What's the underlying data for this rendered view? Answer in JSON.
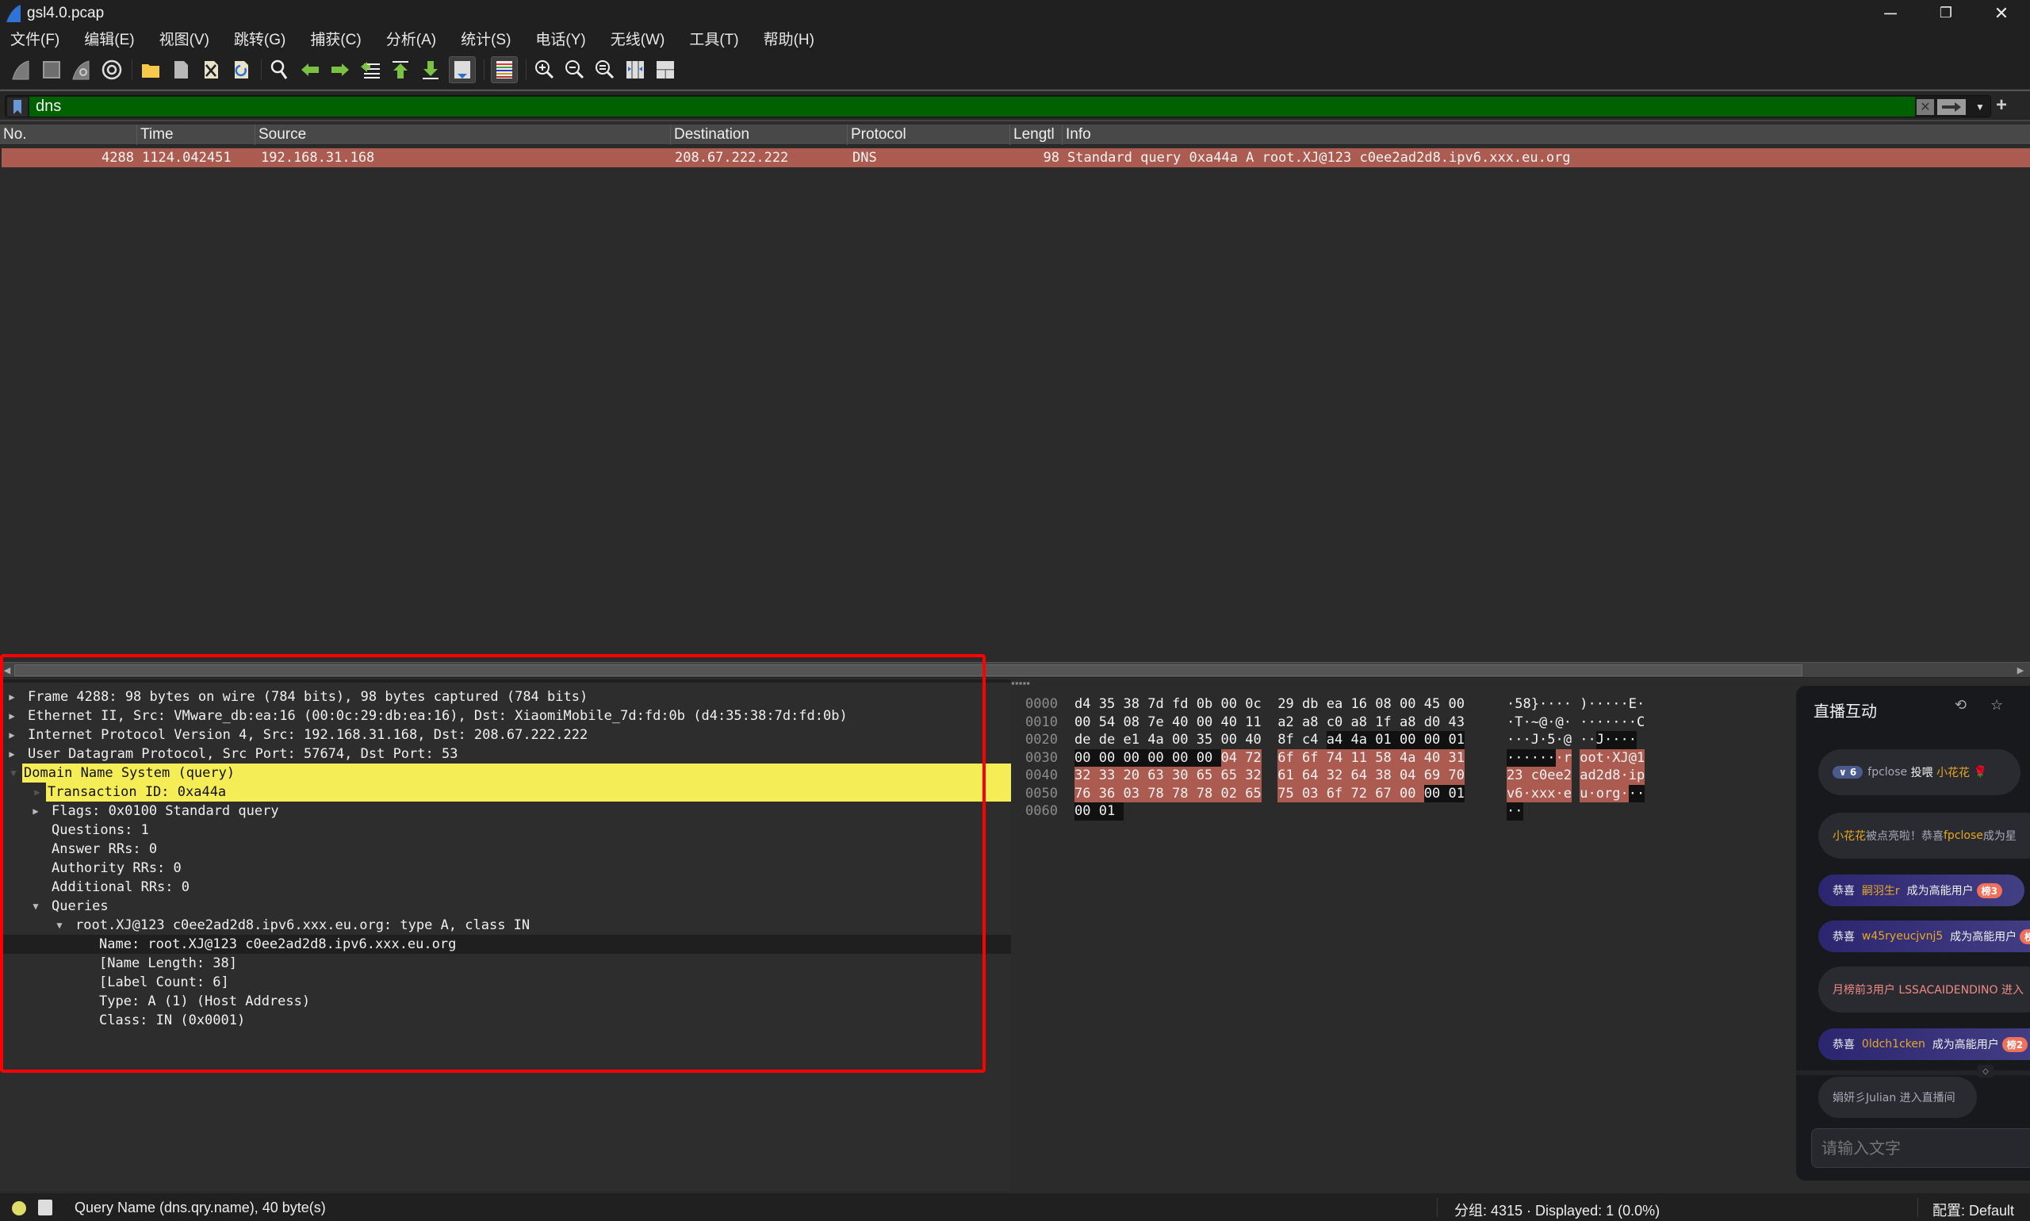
{
  "window": {
    "title": "gsl4.0.pcap",
    "controls": [
      "minimize-icon",
      "restore-icon",
      "close-icon"
    ]
  },
  "menu": [
    "文件(F)",
    "编辑(E)",
    "视图(V)",
    "跳转(G)",
    "捕获(C)",
    "分析(A)",
    "统计(S)",
    "电话(Y)",
    "无线(W)",
    "工具(T)",
    "帮助(H)"
  ],
  "toolbar": [
    "start-capture-icon",
    "stop-capture-icon",
    "restart-capture-icon",
    "capture-options-icon",
    "open-file-icon",
    "save-file-icon",
    "close-file-icon",
    "reload-file-icon",
    "find-packet-icon",
    "go-back-icon",
    "go-forward-icon",
    "go-to-packet-icon",
    "first-packet-icon",
    "last-packet-icon",
    "autoscroll-icon",
    "colorize-icon",
    "zoom-in-icon",
    "zoom-out-icon",
    "zoom-normal-icon",
    "resize-columns-icon",
    "layout-icon"
  ],
  "filter": {
    "value": "dns",
    "color": "#006100"
  },
  "packet_list": {
    "columns": [
      "No.",
      "Time",
      "Source",
      "Destination",
      "Protocol",
      "Length",
      "Info"
    ],
    "column_labels_visible": [
      "No.",
      "Time",
      "Source",
      "Destination",
      "Protocol",
      "Lengtl",
      "Info"
    ],
    "rows": [
      {
        "no": "4288",
        "time": "1124.042451",
        "source": "192.168.31.168",
        "destination": "208.67.222.222",
        "protocol": "DNS",
        "length": "98",
        "info": "Standard query 0xa44a A root.XJ@123 c0ee2ad2d8.ipv6.xxx.eu.org",
        "selected": true,
        "row_color": "#ab5b50"
      }
    ]
  },
  "details": {
    "rows": [
      {
        "level": 0,
        "expander": "collapsed",
        "text": "Frame 4288: 98 bytes on wire (784 bits), 98 bytes captured (784 bits)"
      },
      {
        "level": 0,
        "expander": "collapsed",
        "text": "Ethernet II, Src: VMware_db:ea:16 (00:0c:29:db:ea:16), Dst: XiaomiMobile_7d:fd:0b (d4:35:38:7d:fd:0b)"
      },
      {
        "level": 0,
        "expander": "collapsed",
        "text": "Internet Protocol Version 4, Src: 192.168.31.168, Dst: 208.67.222.222"
      },
      {
        "level": 0,
        "expander": "collapsed",
        "text": "User Datagram Protocol, Src Port: 57674, Dst Port: 53"
      },
      {
        "level": 0,
        "expander": "expanded",
        "text": "Domain Name System (query)",
        "highlight": "yellow"
      },
      {
        "level": 1,
        "expander": "collapsed",
        "text": "Transaction ID: 0xa44a",
        "highlight": "yellow"
      },
      {
        "level": 1,
        "expander": "collapsed",
        "text": "Flags: 0x0100 Standard query"
      },
      {
        "level": 1,
        "expander": "none",
        "text": "Questions: 1"
      },
      {
        "level": 1,
        "expander": "none",
        "text": "Answer RRs: 0"
      },
      {
        "level": 1,
        "expander": "none",
        "text": "Authority RRs: 0"
      },
      {
        "level": 1,
        "expander": "none",
        "text": "Additional RRs: 0"
      },
      {
        "level": 1,
        "expander": "expanded",
        "text": "Queries"
      },
      {
        "level": 2,
        "expander": "expanded",
        "text": "root.XJ@123 c0ee2ad2d8.ipv6.xxx.eu.org: type A, class IN"
      },
      {
        "level": 3,
        "expander": "none",
        "text": "Name: root.XJ@123 c0ee2ad2d8.ipv6.xxx.eu.org",
        "highlight": "selected"
      },
      {
        "level": 3,
        "expander": "none",
        "text": "[Name Length: 38]"
      },
      {
        "level": 3,
        "expander": "none",
        "text": "[Label Count: 6]"
      },
      {
        "level": 3,
        "expander": "none",
        "text": "Type: A (1) (Host Address)"
      },
      {
        "level": 3,
        "expander": "none",
        "text": "Class: IN (0x0001)"
      }
    ],
    "highlight_color": "#f5ed55"
  },
  "bytes": {
    "rows": [
      {
        "offset": "0000",
        "hex": [
          "d4",
          "35",
          "38",
          "7d",
          "fd",
          "0b",
          "00",
          "0c",
          "29",
          "db",
          "ea",
          "16",
          "08",
          "00",
          "45",
          "00"
        ],
        "ascii": "·58}···· )·····E·"
      },
      {
        "offset": "0010",
        "hex": [
          "00",
          "54",
          "08",
          "7e",
          "40",
          "00",
          "40",
          "11",
          "a2",
          "a8",
          "c0",
          "a8",
          "1f",
          "a8",
          "d0",
          "43"
        ],
        "ascii": "·T·~@·@· ·······C"
      },
      {
        "offset": "0020",
        "hex": [
          "de",
          "de",
          "e1",
          "4a",
          "00",
          "35",
          "00",
          "40",
          "8f",
          "c4",
          "a4",
          "4a",
          "01",
          "00",
          "00",
          "01"
        ],
        "ascii": "···J·5·@ ··J····"
      },
      {
        "offset": "0030",
        "hex": [
          "00",
          "00",
          "00",
          "00",
          "00",
          "00",
          "04",
          "72",
          "6f",
          "6f",
          "74",
          "11",
          "58",
          "4a",
          "40",
          "31"
        ],
        "ascii": "·······r oot·XJ@1"
      },
      {
        "offset": "0040",
        "hex": [
          "32",
          "33",
          "20",
          "63",
          "30",
          "65",
          "65",
          "32",
          "61",
          "64",
          "32",
          "64",
          "38",
          "04",
          "69",
          "70"
        ],
        "ascii": "23 c0ee2 ad2d8·ip"
      },
      {
        "offset": "0050",
        "hex": [
          "76",
          "36",
          "03",
          "78",
          "78",
          "78",
          "02",
          "65",
          "75",
          "03",
          "6f",
          "72",
          "67",
          "00",
          "00",
          "01"
        ],
        "ascii": "v6·xxx·e u·org···"
      },
      {
        "offset": "0060",
        "hex": [
          "00",
          "01"
        ],
        "ascii": "··"
      }
    ],
    "dns_range": [
      42,
      98
    ],
    "field_range": [
      54,
      94
    ]
  },
  "live_panel": {
    "title": "直播互动",
    "messages": [
      {
        "style": "dark",
        "level": "6",
        "user": "fpclose",
        "action": "投喂",
        "gift": "小花花"
      },
      {
        "style": "dark",
        "parts": [
          "小花花",
          " 被点亮啦！恭喜 ",
          "fpclose",
          " 成为星"
        ]
      },
      {
        "style": "purple",
        "prefix": "恭喜",
        "user": "嗣羽生r",
        "suffix": "成为高能用户",
        "badge": "榜3"
      },
      {
        "style": "purple",
        "prefix": "恭喜",
        "user": "w45ryeucjvnj5",
        "suffix": "成为高能用户",
        "badge": "榜"
      },
      {
        "style": "dark",
        "text": "月榜前3用户 LSSACAIDENDINO 进入"
      },
      {
        "style": "purple",
        "prefix": "恭喜",
        "user": "0ldch1cken",
        "suffix": "成为高能用户",
        "badge": "榜2"
      },
      {
        "style": "dark",
        "text": "娟妍彡Julian 进入直播间"
      }
    ],
    "input_placeholder": "请输入文字"
  },
  "status": {
    "field_info": "Query Name (dns.qry.name), 40 byte(s)",
    "packets": "分组: 4315 · Displayed: 1 (0.0%)",
    "profile": "配置:  Default"
  }
}
